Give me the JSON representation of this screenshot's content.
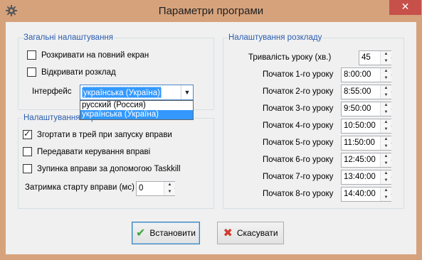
{
  "window": {
    "title": "Параметри програми",
    "close_label": "✕"
  },
  "general": {
    "legend": "Загальні налаштування",
    "fullscreen_label": "Розкривати на повний екран",
    "fullscreen_checked": false,
    "open_schedule_label": "Відкривати розклад",
    "open_schedule_checked": false,
    "interface_label": "Інтерфейс",
    "interface_value": "українська (Україна)",
    "interface_options": [
      "русский (Россия)",
      "українська (Україна)"
    ],
    "interface_selected_index": 1
  },
  "exercise": {
    "legend": "Налаштування вправи",
    "tray_label": "Згортати в трей при запуску вправи",
    "tray_checked": true,
    "transfer_label": "Передавати керування вправі",
    "transfer_checked": false,
    "taskkill_label": "Зупинка вправи за допомогою Taskkill",
    "taskkill_checked": false,
    "delay_label": "Затримка старту вправи (мс)",
    "delay_value": "0"
  },
  "schedule": {
    "legend": "Налаштування розкладу",
    "duration_label": "Тривалість уроку (хв.)",
    "duration_value": "45",
    "lessons": [
      {
        "label": "Початок 1-го уроку",
        "time": "8:00:00"
      },
      {
        "label": "Початок 2-го уроку",
        "time": "8:55:00"
      },
      {
        "label": "Початок 3-го уроку",
        "time": "9:50:00"
      },
      {
        "label": "Початок 4-го уроку",
        "time": "10:50:00"
      },
      {
        "label": "Початок 5-го уроку",
        "time": "11:50:00"
      },
      {
        "label": "Початок 6-го уроку",
        "time": "12:45:00"
      },
      {
        "label": "Початок 7-го уроку",
        "time": "13:40:00"
      },
      {
        "label": "Початок 8-го уроку",
        "time": "14:40:00"
      }
    ]
  },
  "buttons": {
    "apply_label": "Встановити",
    "cancel_label": "Скасувати"
  },
  "icons": {
    "title": "gear-icon",
    "apply": "checkmark-icon",
    "cancel": "x-icon"
  }
}
